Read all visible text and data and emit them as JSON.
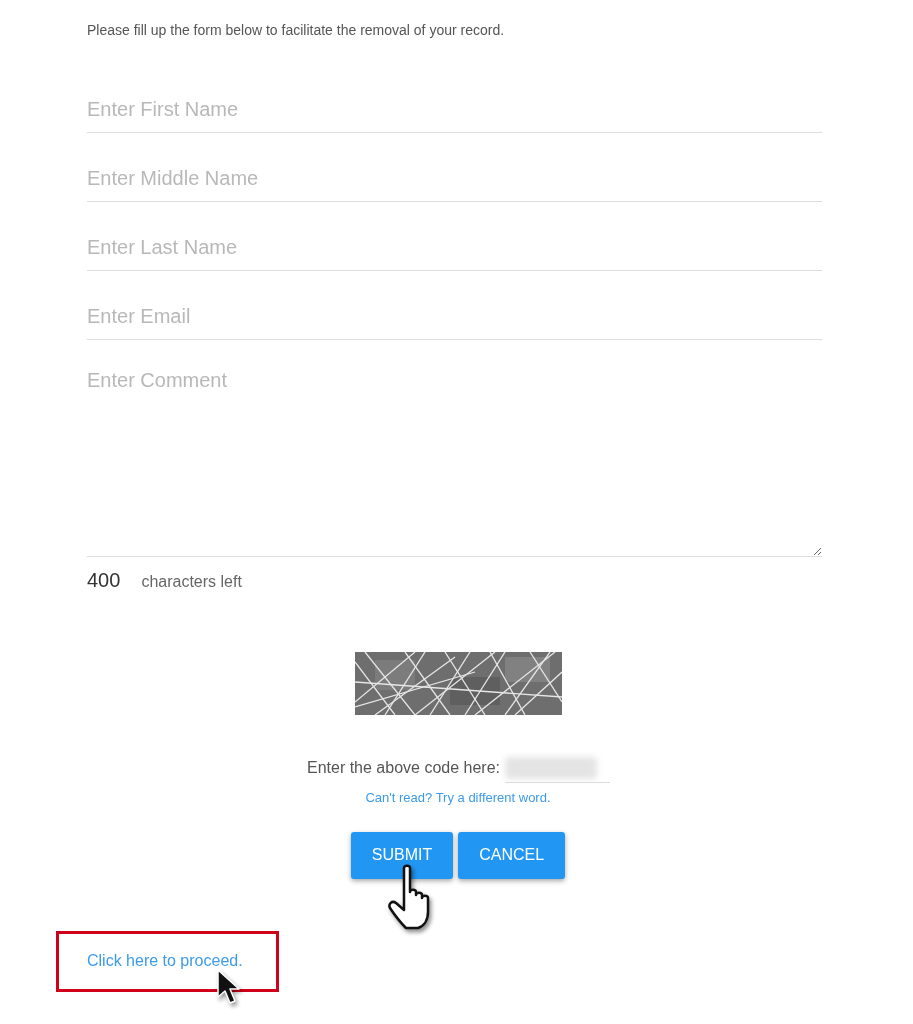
{
  "intro": "Please fill up the form below to facilitate the removal of your record.",
  "fields": [
    {
      "placeholder": "Enter First Name"
    },
    {
      "placeholder": "Enter Middle Name"
    },
    {
      "placeholder": "Enter Last Name"
    },
    {
      "placeholder": "Enter Email"
    }
  ],
  "comment": {
    "placeholder": "Enter Comment",
    "counter": "400",
    "counter_label": "characters left"
  },
  "captcha": {
    "prompt": "Enter the above code here:",
    "refresh_link": "Can't read? Try a different word."
  },
  "buttons": [
    {
      "label": "SUBMIT"
    },
    {
      "label": "CANCEL"
    }
  ],
  "proceed_link": {
    "label": "Click here to proceed.",
    "highlighted": true
  }
}
